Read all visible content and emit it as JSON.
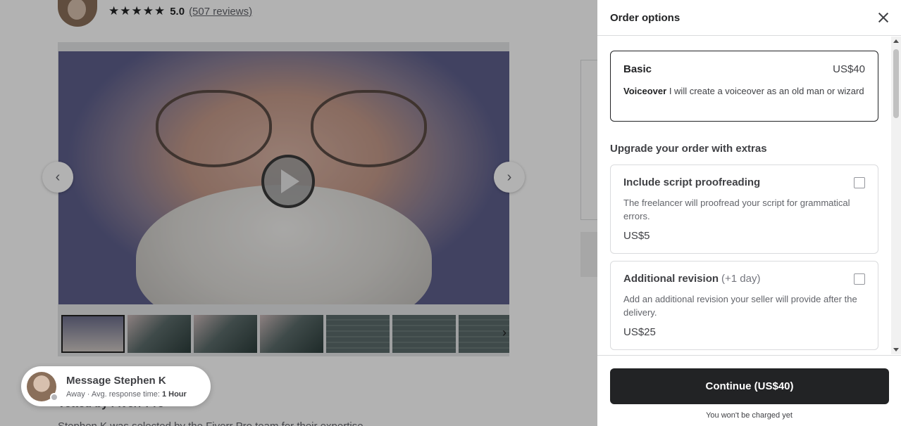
{
  "seller": {
    "stars": "★★★★★",
    "rating": "5.0",
    "reviews": "(507 reviews)"
  },
  "gallery": {
    "prev_icon": "chevron-left-icon",
    "next_icon": "chevron-right-icon",
    "prev_glyph": "‹",
    "next_glyph": "›",
    "thumb_next_glyph": "›"
  },
  "background_text": {
    "vetted": "Vetted by Fiverr Pro",
    "vetted_desc": "Stephen K was selected by the Fiverr Pro team for their expertise."
  },
  "message": {
    "title": "Message Stephen K",
    "status": "Away",
    "separator": "·",
    "response_label": "Avg. response time:",
    "response_value": "1 Hour"
  },
  "drawer": {
    "title": "Order options",
    "package": {
      "name": "Basic",
      "price": "US$40",
      "label": "Voiceover",
      "description": "I will create a voiceover as an old man or wizard"
    },
    "extras_title": "Upgrade your order with extras",
    "extras": [
      {
        "name": "Include script proofreading",
        "note": "",
        "description": "The freelancer will proofread your script for grammatical errors.",
        "price": "US$5",
        "checked": false
      },
      {
        "name": "Additional revision",
        "note": "(+1 day)",
        "description": "Add an additional revision your seller will provide after the delivery.",
        "price": "US$25",
        "checked": false
      }
    ],
    "continue_label": "Continue  (US$40)",
    "charge_note": "You won't be charged yet"
  },
  "colors": {
    "primary_button": "#222325",
    "overlay": "rgba(0,0,0,0.3)",
    "border": "#dadbdd"
  }
}
